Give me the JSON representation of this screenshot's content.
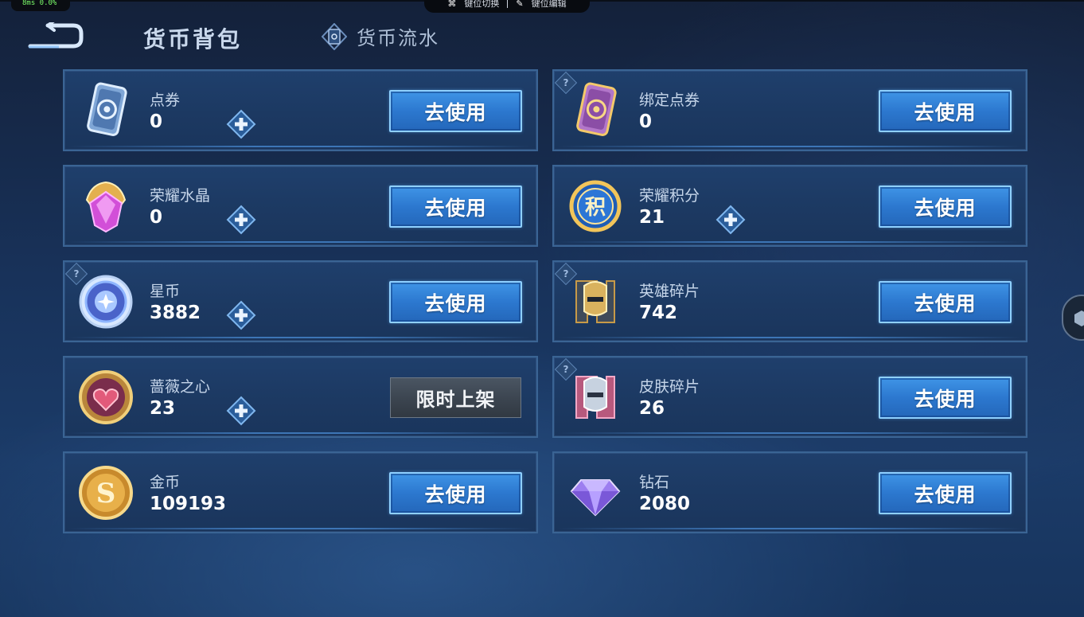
{
  "overlay": {
    "perf": "8ms  0.0%",
    "btn_a": "键位切换",
    "btn_b": "键位编辑"
  },
  "header": {
    "title": "货币背包",
    "tab_label": "货币流水"
  },
  "action_labels": {
    "use": "去使用",
    "limited": "限时上架"
  },
  "currencies": [
    {
      "name": "点券",
      "amount": "0",
      "icon": "coupon-card-icon",
      "plus": true,
      "help": false,
      "action": "use"
    },
    {
      "name": "绑定点券",
      "amount": "0",
      "icon": "bound-coupon-card-icon",
      "plus": false,
      "help": true,
      "action": "use"
    },
    {
      "name": "荣耀水晶",
      "amount": "0",
      "icon": "glory-crystal-icon",
      "plus": true,
      "help": false,
      "action": "use"
    },
    {
      "name": "荣耀积分",
      "amount": "21",
      "icon": "glory-points-icon",
      "plus": true,
      "help": false,
      "action": "use"
    },
    {
      "name": "星币",
      "amount": "3882",
      "icon": "star-coin-icon",
      "plus": true,
      "help": true,
      "action": "use"
    },
    {
      "name": "英雄碎片",
      "amount": "742",
      "icon": "hero-fragment-icon",
      "plus": false,
      "help": true,
      "action": "use"
    },
    {
      "name": "蔷薇之心",
      "amount": "23",
      "icon": "rose-heart-icon",
      "plus": true,
      "help": false,
      "action": "limited"
    },
    {
      "name": "皮肤碎片",
      "amount": "26",
      "icon": "skin-fragment-icon",
      "plus": false,
      "help": true,
      "action": "use"
    },
    {
      "name": "金币",
      "amount": "109193",
      "icon": "gold-coin-icon",
      "plus": false,
      "help": false,
      "action": "use"
    },
    {
      "name": "钻石",
      "amount": "2080",
      "icon": "diamond-icon",
      "plus": false,
      "help": false,
      "action": "use"
    }
  ]
}
